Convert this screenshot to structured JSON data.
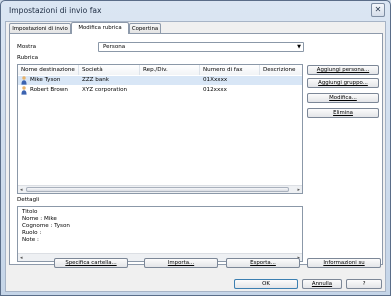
{
  "window": {
    "title": "Impostazioni di invio fax",
    "close_symbol": "✕"
  },
  "tabs": [
    {
      "label": "Impostazioni di invio"
    },
    {
      "label": "Modifica rubrica"
    },
    {
      "label": "Copertina"
    }
  ],
  "mostra": {
    "label": "Mostra",
    "value": "Persona"
  },
  "rubrica": {
    "label": "Rubrica",
    "columns": [
      "Nome destinazione",
      "Società",
      "Rep./Div.",
      "Numero di fax",
      "Descrizione"
    ],
    "rows": [
      {
        "name": "Mike Tyson",
        "company": "ZZZ bank",
        "dept": "",
        "fax": "01Xxxxx",
        "desc": ""
      },
      {
        "name": "Robert Brown",
        "company": "XYZ corporation",
        "dept": "",
        "fax": "012xxxx",
        "desc": ""
      }
    ]
  },
  "side_buttons": {
    "add_person": "Aggiungi persona...",
    "add_group": "Aggiungi gruppo...",
    "edit": "Modifica...",
    "delete": "Elimina"
  },
  "dettagli": {
    "label": "Dettagli",
    "lines": [
      "Titolo",
      "Nome    : Mike",
      "Cognome : Tyson",
      "Ruolo   :",
      "Note    :"
    ]
  },
  "bottom_buttons": {
    "specify_folder": "Specifica cartella...",
    "import": "Importa...",
    "export": "Esporta...",
    "info": "Informazioni su"
  },
  "dialog_buttons": {
    "ok": "OK",
    "cancel": "Annulla",
    "help": "?"
  },
  "colors": {
    "selection": "#d8e6f6",
    "window_frame": "#c5d5e8"
  }
}
